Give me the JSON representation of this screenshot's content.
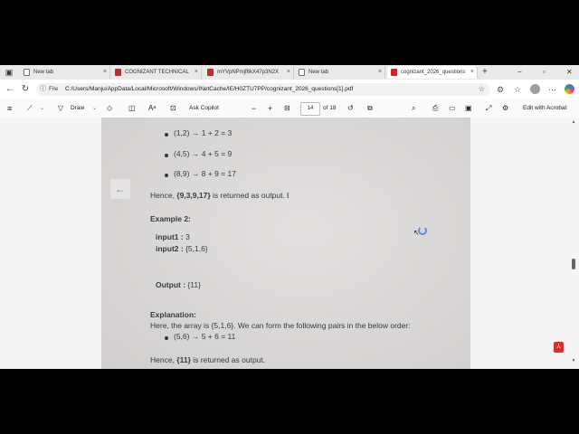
{
  "tabs": [
    {
      "label": "New tab",
      "type": "page",
      "active": false
    },
    {
      "label": "COGNIZANT TECHNICAL",
      "type": "pdf",
      "active": false
    },
    {
      "label": "mYVpNPmjf6kX47p3N2X",
      "type": "pdf",
      "active": false
    },
    {
      "label": "New tab",
      "type": "page",
      "active": false
    },
    {
      "label": "cognizant_2026_questions",
      "type": "pdf",
      "active": true
    }
  ],
  "tab_close": "×",
  "new_tab": "+",
  "window_controls": {
    "minimize": "−",
    "maximize": "▫",
    "close": "✕"
  },
  "address": {
    "file_label": "File",
    "url": "C:/Users/Manju/AppData/Local/Microsoft/Windows/INetCache/IE/H0ZTU7PP/cognizant_2026_questions[1].pdf"
  },
  "pdf_toolbar": {
    "draw_label": "Draw",
    "ask_copilot": "Ask Copilot",
    "zoom_out": "−",
    "zoom_in": "+",
    "page_current": "14",
    "page_total": "of 18",
    "edit_acrobat": "Edit with Acrobat"
  },
  "document": {
    "bullets_top": [
      "(1,2) → 1 + 2 = 3",
      "(4,5) → 4 + 5 = 9",
      "(8,9) → 8 + 9 = 17"
    ],
    "hence1_prefix": "Hence, ",
    "hence1_value": "{9,3,9,17}",
    "hence1_suffix": " is returned as output.",
    "example_heading": "Example 2:",
    "input1_label": "input1 :",
    "input1_value": " 3",
    "input2_label": "input2 :",
    "input2_value": " {5,1,6}",
    "output_label": "Output :",
    "output_value": " {11}",
    "explanation_heading": "Explanation:",
    "explanation_text": "Here, the array is {5,1,6}. We can form the following pairs in the below order:",
    "bullet_bottom": "(5,6) → 5 + 6 = 11",
    "hence2_prefix": "Hence, ",
    "hence2_value": "{11}",
    "hence2_suffix": " is returned as output."
  }
}
